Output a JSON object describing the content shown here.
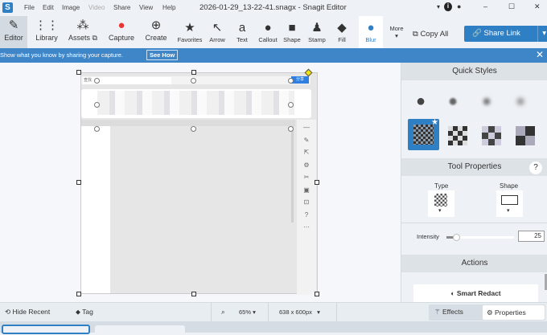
{
  "app": {
    "logo": "S",
    "title": "2026-01-29_13-22-41.snagx - Snagit Editor"
  },
  "menu": [
    "File",
    "Edit",
    "Image",
    "Video",
    "Share",
    "View",
    "Help"
  ],
  "window_controls": {
    "minimize": "–",
    "maximize": "☐",
    "close": "✕"
  },
  "toolbar": {
    "left": [
      {
        "label": "Editor",
        "icon": "edit-icon"
      },
      {
        "label": "Library",
        "icon": "grid-icon"
      },
      {
        "label": "Assets",
        "icon": "assets-icon"
      },
      {
        "label": "Capture",
        "icon": "record-icon"
      },
      {
        "label": "Create",
        "icon": "plus-icon"
      }
    ],
    "tools": [
      {
        "label": "Favorites",
        "icon": "★"
      },
      {
        "label": "Arrow",
        "icon": "↖"
      },
      {
        "label": "Text",
        "icon": "a"
      },
      {
        "label": "Callout",
        "icon": "●"
      },
      {
        "label": "Shape",
        "icon": "■"
      },
      {
        "label": "Stamp",
        "icon": "♟"
      },
      {
        "label": "Fill",
        "icon": "◆"
      },
      {
        "label": "Blur",
        "icon": "💧"
      }
    ],
    "more": "More",
    "copy_all": "Copy All",
    "share_link": "Share Link",
    "active_tool": "Blur"
  },
  "banner": {
    "text": "Show what you know by sharing your capture.",
    "button": "See How"
  },
  "capture": {
    "share_btn": "分享",
    "search_text": "查找"
  },
  "panel": {
    "quick_styles": "Quick Styles",
    "tool_properties": "Tool Properties",
    "help": "?",
    "type_label": "Type",
    "shape_label": "Shape",
    "intensity_label": "Intensity",
    "intensity": 25,
    "actions": "Actions",
    "smart_redact": "Smart Redact"
  },
  "bottom": {
    "hide_recent": "Hide Recent",
    "tag": "Tag",
    "zoom": "65%",
    "size": "638 x 600px",
    "effects": "Effects",
    "properties": "Properties"
  },
  "colors": {
    "accent": "#3f86c8",
    "selected": "#2f7fc4"
  }
}
